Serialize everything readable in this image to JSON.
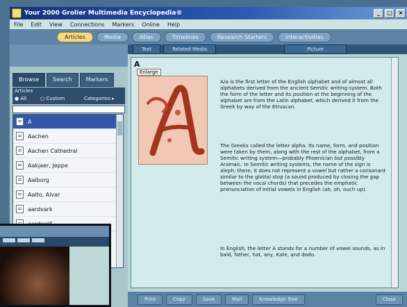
{
  "window": {
    "title": "Your 2000 Grolier Multimedia Encyclopedia®"
  },
  "menu": [
    "File",
    "Edit",
    "View",
    "Connections",
    "Markers",
    "Online",
    "Help"
  ],
  "modes": [
    {
      "label": "Articles",
      "active": true
    },
    {
      "label": "Media",
      "active": false
    },
    {
      "label": "Atlas",
      "active": false
    },
    {
      "label": "Timelines",
      "active": false
    },
    {
      "label": "Research Starters",
      "active": false
    },
    {
      "label": "Interactivities",
      "active": false
    }
  ],
  "browse_tabs": [
    "Browse",
    "Search",
    "Markers"
  ],
  "list_header": {
    "label": "Articles",
    "options": [
      "All",
      "Custom",
      "Categories"
    ]
  },
  "article_list": [
    {
      "label": "A",
      "selected": true
    },
    {
      "label": "Aachen",
      "selected": false
    },
    {
      "label": "Aachen Cathedral",
      "selected": false
    },
    {
      "label": "Aakjaer, Jeppe",
      "selected": false
    },
    {
      "label": "Aalborg",
      "selected": false
    },
    {
      "label": "Aalto, Alvar",
      "selected": false
    },
    {
      "label": "aardvark",
      "selected": false
    },
    {
      "label": "aardwolf",
      "selected": false
    }
  ],
  "content_tabs": [
    "Text",
    "Related Media"
  ],
  "picture_tab": "Picture",
  "article": {
    "heading": "A",
    "enlarge_label": "Enlarge",
    "paragraphs": [
      "A/a is the first letter of the English alphabet and of almost all alphabets derived from the ancient Semitic writing system. Both the form of the letter and its position at the beginning of the alphabet are from the Latin alphabet, which derived it from the Greek by way of the Etruscan.",
      "The Greeks called the letter alpha. Its name, form, and position were taken by them, along with the rest of the alphabet, from a Semitic writing system—probably Phoenician but possibly Aramaic. In Semitic writing systems, the name of the sign is aleph; there, it does not represent a vowel but rather a consonant similar to the glottal stop (a sound produced by closing the gap between the vocal chords) that precedes the emphatic pronunciation of initial vowels in English (ah, oh, ouch up).",
      "In English, the letter A stands for a number of vowel sounds, as in bald, father, hat, any, Kate, and dodo."
    ]
  },
  "bottom_buttons": [
    "Print",
    "Copy",
    "Save",
    "Mail",
    "Knowledge Tree"
  ],
  "close_button": "Close"
}
